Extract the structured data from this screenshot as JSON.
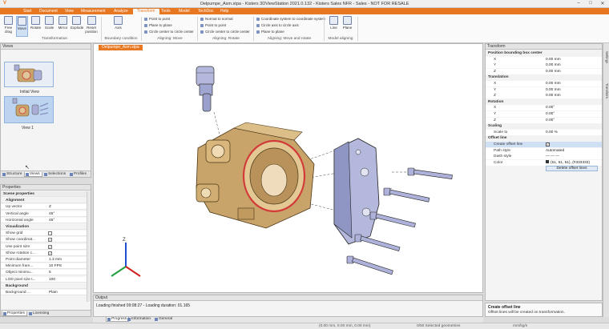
{
  "app": {
    "title": "Oelpumpe_Asm.stpa - Kisters 3DViewStation 2021.0.132 - Kisters Sales NFR - Sales - NOT FOR RESALE",
    "logo": "V"
  },
  "menu": [
    "Start",
    "Document",
    "View",
    "Measurement",
    "Analyze",
    "Transform",
    "Tools",
    "Model",
    "TechDoc",
    "Help"
  ],
  "menu_active": "Transform",
  "ribbon": {
    "big_buttons": [
      {
        "label": "Free drag"
      },
      {
        "label": "Move"
      },
      {
        "label": "Rotate"
      },
      {
        "label": "Scale"
      },
      {
        "label": "Mirror"
      },
      {
        "label": "Explode"
      },
      {
        "label": "Reset position"
      },
      {
        "label": "Axis"
      },
      {
        "label": "Line"
      },
      {
        "label": "Plane"
      }
    ],
    "align_move": [
      "Point to point",
      "Plane to plane",
      "Circle center to circle center"
    ],
    "align_rotate": [
      "Normal to normal",
      "Point to point",
      "Circle center to circle center"
    ],
    "align_move_rotate": [
      "Coordinate system to coordinate system",
      "Circle axis to circle axis",
      "Plane to plane"
    ],
    "groups": [
      "Transformation",
      "Boundary condition",
      "Aligning: Move",
      "Aligning: Rotate",
      "Aligning: Move and rotate",
      "Model aligning"
    ]
  },
  "views_panel": {
    "title": "Views",
    "items": [
      {
        "label": "Initial View"
      },
      {
        "label": "View 1"
      }
    ],
    "tabs": [
      "Structure",
      "Views",
      "Selections",
      "Profiles"
    ],
    "active_tab": "Views"
  },
  "properties_panel": {
    "title": "Properties",
    "rows": [
      {
        "type": "sec",
        "key": "Scene properties",
        "value": ""
      },
      {
        "type": "sub",
        "key": "Alignment",
        "value": ""
      },
      {
        "type": "row",
        "key": "Up vector",
        "value": "Z"
      },
      {
        "type": "row",
        "key": "Vertical angle",
        "value": "45°"
      },
      {
        "type": "row",
        "key": "Horizontal angle",
        "value": "45°"
      },
      {
        "type": "sub",
        "key": "Visualization",
        "value": ""
      },
      {
        "type": "check",
        "key": "Show grid",
        "value": ""
      },
      {
        "type": "check",
        "key": "Show coordinat...",
        "value": "✓"
      },
      {
        "type": "check",
        "key": "Use point size",
        "value": "✓"
      },
      {
        "type": "check",
        "key": "Show rotation c...",
        "value": "✓"
      },
      {
        "type": "row",
        "key": "Point diameter",
        "value": "1.3 mm"
      },
      {
        "type": "row",
        "key": "Minimum fram...",
        "value": "10 FPS"
      },
      {
        "type": "row",
        "key": "Object minimu...",
        "value": "5"
      },
      {
        "type": "row",
        "key": "LOD pixel size t...",
        "value": "100"
      },
      {
        "type": "sub",
        "key": "Background",
        "value": ""
      },
      {
        "type": "row",
        "key": "Background ...",
        "value": "Plain"
      }
    ],
    "tabs": [
      "Properties",
      "Licensing"
    ],
    "active_tab": "Properties"
  },
  "viewport": {
    "doc_tab": "Oelpumpe_Asm.stpa"
  },
  "output_panel": {
    "title": "Output",
    "line": "Loading finished 09:08:27 - Loading duration: 01.165",
    "tabs": [
      "Progress",
      "Information",
      "General"
    ],
    "active_tab": "Progress"
  },
  "transform_panel": {
    "title": "Transform",
    "rows": [
      {
        "type": "sec",
        "key": "Position bounding box center",
        "value": ""
      },
      {
        "type": "row",
        "key": "X",
        "value": "0.00 mm"
      },
      {
        "type": "row",
        "key": "Y",
        "value": "0.00 mm"
      },
      {
        "type": "row",
        "key": "Z",
        "value": "0.00 mm"
      },
      {
        "type": "sec",
        "key": "Translation",
        "value": ""
      },
      {
        "type": "row",
        "key": "X",
        "value": "0.00 mm"
      },
      {
        "type": "row",
        "key": "Y",
        "value": "0.00 mm"
      },
      {
        "type": "row",
        "key": "Z",
        "value": "0.00 mm"
      },
      {
        "type": "sec",
        "key": "Rotation",
        "value": ""
      },
      {
        "type": "row",
        "key": "X",
        "value": "0.00°"
      },
      {
        "type": "row",
        "key": "Y",
        "value": "0.00°"
      },
      {
        "type": "row",
        "key": "Z",
        "value": "0.00°"
      },
      {
        "type": "sec",
        "key": "Scaling",
        "value": ""
      },
      {
        "type": "row",
        "key": "Scale to",
        "value": "0.00 %"
      },
      {
        "type": "sec",
        "key": "Offset line",
        "value": ""
      },
      {
        "type": "hl",
        "key": "Create offset line",
        "value": "✓"
      },
      {
        "type": "row",
        "key": "Path style",
        "value": "Automated"
      },
      {
        "type": "row",
        "key": "Dash style",
        "value": "— — —"
      },
      {
        "type": "color",
        "key": "Color",
        "value": "(51, 51, 51), (#333333)"
      },
      {
        "type": "button",
        "key": "",
        "value": "Delete offset lines"
      }
    ]
  },
  "tip_panel": {
    "title": "Create offset line",
    "text": "Offset lines will be created on transformation."
  },
  "side_tabs": [
    "Settings",
    "Transform"
  ],
  "statusbar": {
    "coords": "(0.00 mm, 0.00 mm, 0.00 mm)",
    "selection": "0/50 Selected geometries",
    "units": "mm/kg/s"
  },
  "colors": {
    "accent": "#e87722",
    "part_gold": "#c9a46a",
    "part_steel": "#a9aed6",
    "seal_red": "#d23a3a"
  }
}
